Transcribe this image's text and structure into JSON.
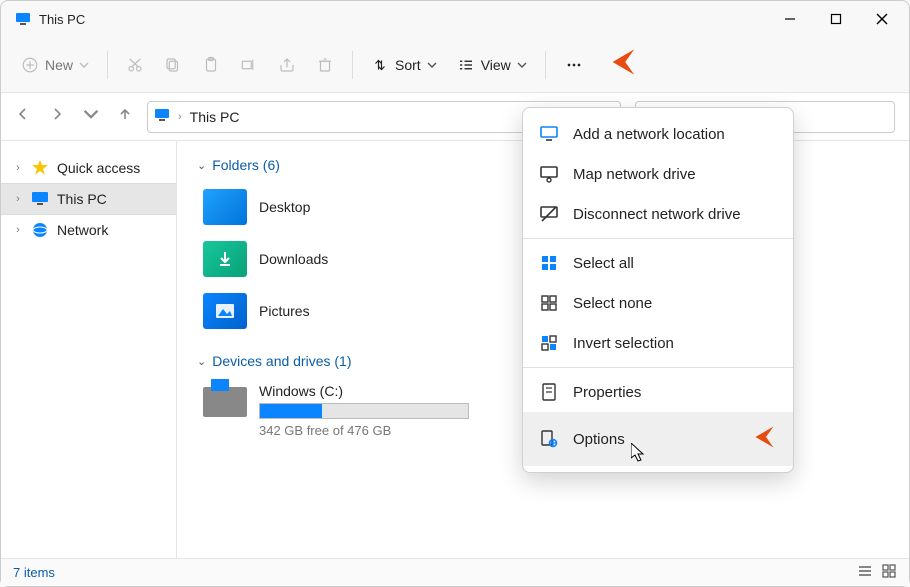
{
  "window": {
    "title": "This PC"
  },
  "toolbar": {
    "new_label": "New",
    "sort_label": "Sort",
    "view_label": "View"
  },
  "addressbar": {
    "current": "This PC"
  },
  "sidebar": {
    "items": [
      {
        "label": "Quick access"
      },
      {
        "label": "This PC"
      },
      {
        "label": "Network"
      }
    ]
  },
  "content": {
    "folders_header": "Folders (6)",
    "folders": [
      {
        "label": "Desktop"
      },
      {
        "label": "Downloads"
      },
      {
        "label": "Pictures"
      }
    ],
    "drives_header": "Devices and drives (1)",
    "drive": {
      "label": "Windows (C:)",
      "used_pct": 30,
      "free_text": "342 GB free of 476 GB"
    }
  },
  "menu": {
    "items": [
      "Add a network location",
      "Map network drive",
      "Disconnect network drive",
      "Select all",
      "Select none",
      "Invert selection",
      "Properties",
      "Options"
    ]
  },
  "statusbar": {
    "text": "7 items"
  }
}
